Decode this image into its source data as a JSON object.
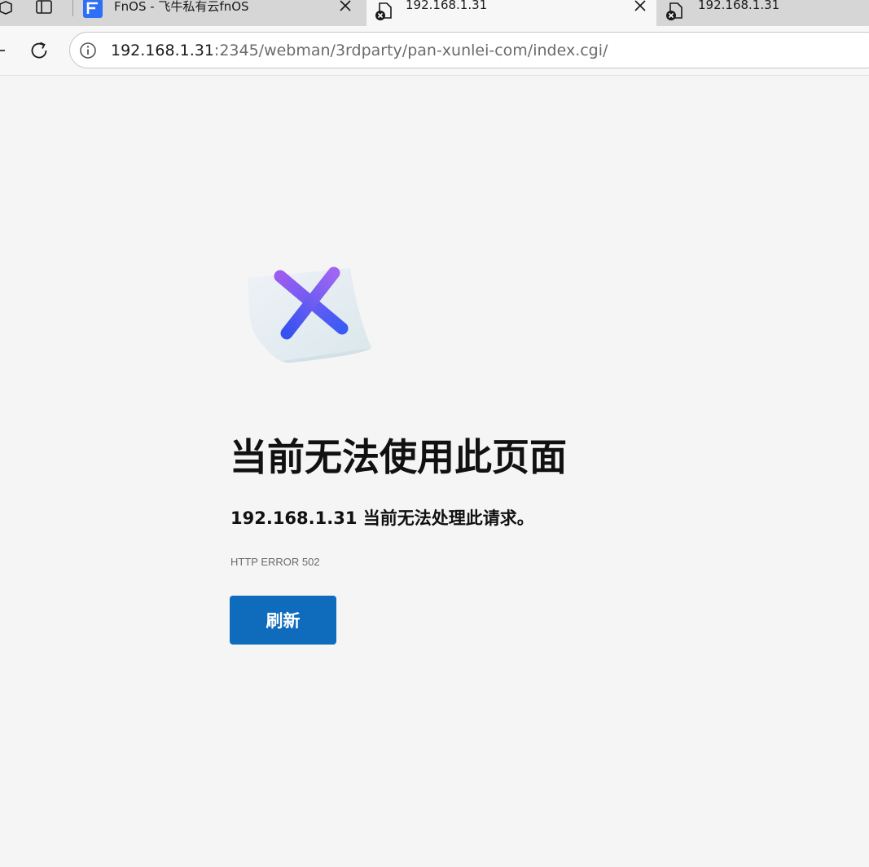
{
  "tabs": [
    {
      "title": "FnOS - 飞牛私有云fnOS",
      "favicon": "fnos-logo-icon",
      "active": false
    },
    {
      "title": "192.168.1.31",
      "favicon": "page-error-icon",
      "active": true
    },
    {
      "title": "192.168.1.31",
      "favicon": "page-error-icon",
      "active": false
    }
  ],
  "address": {
    "host": "192.168.1.31",
    "rest": ":2345/webman/3rdparty/pan-xunlei-com/index.cgi/",
    "site_info_icon": "info-icon"
  },
  "error_page": {
    "illustration": "error-x-note-icon",
    "headline": "当前无法使用此页面",
    "message": "192.168.1.31 当前无法处理此请求。",
    "error_code": "HTTP ERROR 502",
    "refresh_label": "刷新"
  },
  "colors": {
    "accent": "#0f6cbd",
    "tabstrip": "#d6d6d6",
    "page_background": "#f5f5f5",
    "x_gradient_start": "#9b5cf0",
    "x_gradient_end": "#3b5bf5"
  }
}
